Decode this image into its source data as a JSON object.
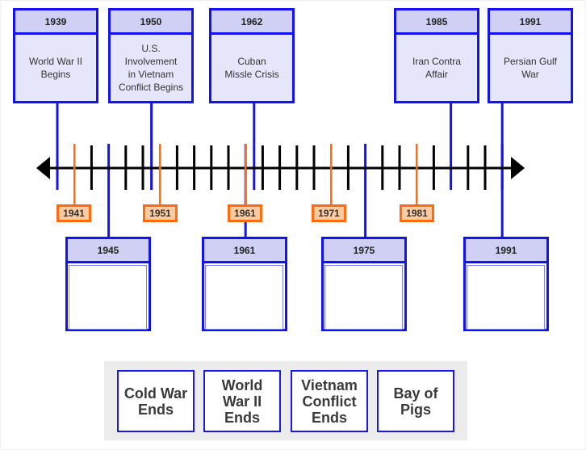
{
  "colors": {
    "event_line": "#1212f4",
    "marker_line": "#ff6a13",
    "tick": "#000000",
    "axis": "#000000"
  },
  "timeline": {
    "start_year": 1937,
    "end_year": 1994,
    "minor_tick_years": [
      1943,
      1947,
      1949,
      1953,
      1955,
      1957,
      1959,
      1963,
      1965,
      1967,
      1969,
      1973,
      1977,
      1979,
      1983,
      1987,
      1989
    ],
    "markers": [
      {
        "year": "1941"
      },
      {
        "year": "1951"
      },
      {
        "year": "1961"
      },
      {
        "year": "1971"
      },
      {
        "year": "1981"
      }
    ]
  },
  "top_events": [
    {
      "year": "1939",
      "label": "World War II\nBegins"
    },
    {
      "year": "1950",
      "label": "U.S.\nInvolvement\nin Vietnam\nConflict Begins"
    },
    {
      "year": "1962",
      "label": "Cuban\nMissle Crisis"
    },
    {
      "year": "1985",
      "label": "Iran Contra\nAffair"
    },
    {
      "year": "1991",
      "label": "Persian Gulf\nWar"
    }
  ],
  "bottom_events": [
    {
      "year": "1945",
      "label": ""
    },
    {
      "year": "1961",
      "label": ""
    },
    {
      "year": "1975",
      "label": ""
    },
    {
      "year": "1991",
      "label": ""
    }
  ],
  "answer_cards": [
    {
      "label": "Cold War\nEnds"
    },
    {
      "label": "World\nWar II\nEnds"
    },
    {
      "label": "Vietnam\nConflict\nEnds"
    },
    {
      "label": "Bay of\nPigs"
    }
  ]
}
